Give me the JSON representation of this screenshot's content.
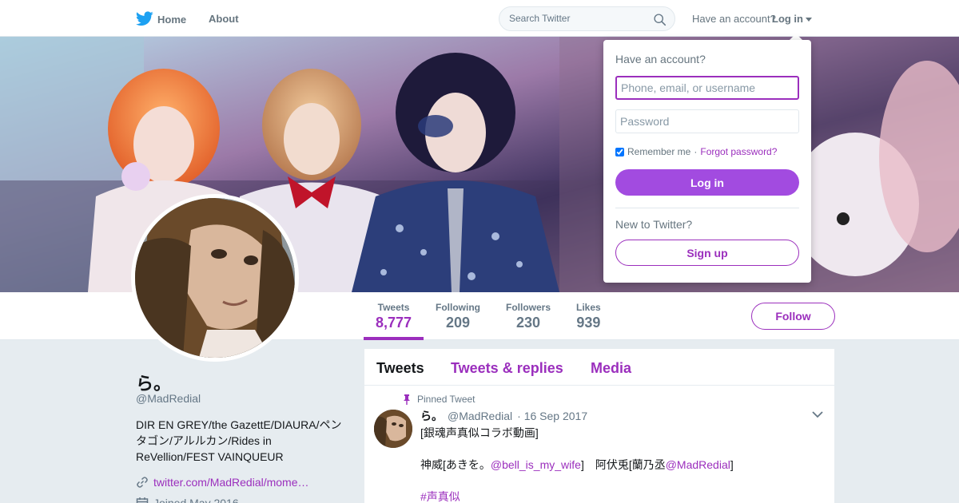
{
  "nav": {
    "home_label": "Home",
    "about_label": "About",
    "search_placeholder": "Search Twitter",
    "have_account": "Have an account?",
    "login_label": "Log in"
  },
  "profile": {
    "name": "ら。",
    "handle": "@MadRedial",
    "bio_lines": [
      "DIR EN GREY/the GazettE/DIAURA/ペン",
      "タゴン/アルルカン/Rides in",
      "ReVellion/FEST VAINQUEUR"
    ],
    "link": "twitter.com/MadRedial/mome…",
    "joined": "Joined May 2016",
    "follow_label": "Follow"
  },
  "stats": [
    {
      "label": "Tweets",
      "value": "8,777"
    },
    {
      "label": "Following",
      "value": "209"
    },
    {
      "label": "Followers",
      "value": "230"
    },
    {
      "label": "Likes",
      "value": "939"
    }
  ],
  "timeline": {
    "tabs": [
      "Tweets",
      "Tweets & replies",
      "Media"
    ],
    "pinned_label": "Pinned Tweet",
    "tweet": {
      "name": "ら。",
      "handle": "@MadRedial",
      "date": "· 16 Sep 2017",
      "line1": "[銀魂声真似コラボ動画]",
      "line2_prefix": "神威[あきを。",
      "line2_link1": "@bell_is_my_wife",
      "line2_mid": "]　阿伏兎[蘭乃丞",
      "line2_link2": "@MadRedial",
      "line2_suffix": "]",
      "hashtag": "#声真似"
    }
  },
  "login_dropdown": {
    "title": "Have an account?",
    "username_placeholder": "Phone, email, or username",
    "password_placeholder": "Password",
    "remember_label": "Remember me",
    "separator": "·",
    "forgot_label": "Forgot password?",
    "login_button": "Log in",
    "new_label": "New to Twitter?",
    "signup_button": "Sign up"
  },
  "colors": {
    "accent": "#9b2fbd",
    "login_button_bg": "#a24be0",
    "page_bg": "#e6ecf0",
    "twitter_blue": "#1da1f2"
  },
  "icons": [
    "twitter-bird-icon",
    "search-icon",
    "caret-down-icon",
    "pin-icon",
    "link-icon",
    "calendar-icon",
    "chevron-down-icon"
  ]
}
